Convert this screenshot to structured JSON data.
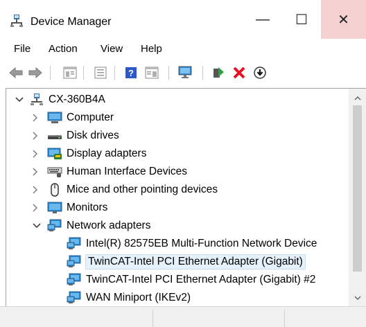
{
  "window": {
    "title": "Device Manager",
    "minimize_glyph": "—",
    "maximize_glyph": "☐",
    "close_glyph": "✕",
    "close_hover_color": "#f4d0d0"
  },
  "menu": [
    "File",
    "Action",
    "View",
    "Help"
  ],
  "toolbar": {
    "icons": [
      "back-icon",
      "forward-icon",
      "properties-icon",
      "show-hidden-icon",
      "help-icon",
      "view-resources-icon",
      "scan-hardware-icon",
      "update-driver-icon",
      "uninstall-icon",
      "disable-device-icon"
    ]
  },
  "tree": {
    "root": {
      "label": "CX-360B4A",
      "expanded": true
    },
    "categories": [
      {
        "label": "Computer",
        "icon": "computer-icon",
        "expanded": false
      },
      {
        "label": "Disk drives",
        "icon": "disk-drive-icon",
        "expanded": false
      },
      {
        "label": "Display adapters",
        "icon": "display-adapter-icon",
        "expanded": false
      },
      {
        "label": "Human Interface Devices",
        "icon": "hid-icon",
        "expanded": false
      },
      {
        "label": "Mice and other pointing devices",
        "icon": "mouse-icon",
        "expanded": false
      },
      {
        "label": "Monitors",
        "icon": "monitor-icon",
        "expanded": false
      },
      {
        "label": "Network adapters",
        "icon": "network-adapter-icon",
        "expanded": true
      }
    ],
    "network_devices": [
      {
        "label": "Intel(R) 82575EB Multi-Function Network Device",
        "selected": false
      },
      {
        "label": "TwinCAT-Intel PCI Ethernet Adapter (Gigabit)",
        "selected": true
      },
      {
        "label": "TwinCAT-Intel PCI Ethernet Adapter (Gigabit) #2",
        "selected": false
      },
      {
        "label": "WAN Miniport (IKEv2)",
        "selected": false
      }
    ]
  },
  "colors": {
    "selection": "#e5f1fb",
    "monitor_blue": "#1e88d6",
    "green_arrow": "#2ea043",
    "red_x": "#e81123"
  }
}
